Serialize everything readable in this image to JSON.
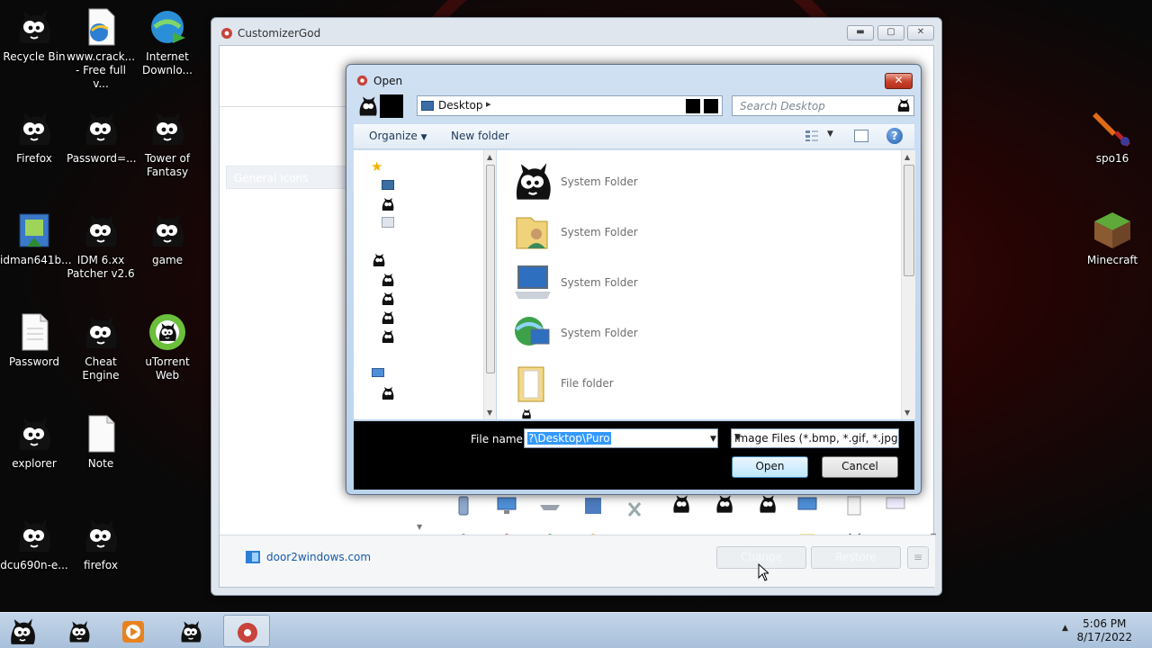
{
  "desktop": {
    "icons": [
      {
        "label": "Recycle Bin",
        "icon": "puro-icon"
      },
      {
        "label": "www.crack...\n- Free full v...",
        "icon": "ie-icon"
      },
      {
        "label": "Internet\nDownlo...",
        "icon": "idm-icon"
      },
      {
        "label": "Firefox",
        "icon": "puro-icon"
      },
      {
        "label": "Password=...",
        "icon": "puro-icon"
      },
      {
        "label": "Tower of\nFantasy",
        "icon": "puro-icon"
      },
      {
        "label": "idman641b...",
        "icon": "installer-icon"
      },
      {
        "label": "IDM 6.xx\nPatcher v2.6",
        "icon": "puro-icon"
      },
      {
        "label": "game",
        "icon": "puro-icon"
      },
      {
        "label": "Password",
        "icon": "text-file-icon"
      },
      {
        "label": "Cheat Engine",
        "icon": "puro-icon"
      },
      {
        "label": "uTorrent\nWeb",
        "icon": "utorrent-icon"
      },
      {
        "label": "explorer",
        "icon": "puro-icon"
      },
      {
        "label": "Note",
        "icon": "text-file-icon"
      },
      {
        "label": "dcu690n-e...",
        "icon": "puro-icon"
      },
      {
        "label": "firefox",
        "icon": "puro-icon"
      },
      {
        "label": "spo16",
        "icon": "sword-icon"
      },
      {
        "label": "Minecraft",
        "icon": "minecraft-icon"
      }
    ]
  },
  "customizer": {
    "title": "CustomizerGod",
    "left_panel_label": "General Icons",
    "footer_link": "door2windows.com",
    "change_label": "Change",
    "restore_label": "Restore",
    "menu_label": "≡"
  },
  "open_dialog": {
    "title": "Open",
    "close_label": "✕",
    "location": "Desktop",
    "search_placeholder": "Search Desktop",
    "organize_label": "Organize",
    "new_folder_label": "New folder",
    "help_label": "?",
    "files": [
      {
        "type": "System Folder",
        "icon": "puro-icon"
      },
      {
        "type": "System Folder",
        "icon": "user-folder-icon"
      },
      {
        "type": "System Folder",
        "icon": "computer-icon"
      },
      {
        "type": "System Folder",
        "icon": "network-icon"
      },
      {
        "type": "File folder",
        "icon": "folder-icon"
      }
    ],
    "file_name_label": "File name:",
    "file_name_value": "?\\Desktop\\Puro",
    "file_type_value": "Image Files (*.bmp, *.gif, *.jpg,",
    "open_label": "Open",
    "cancel_label": "Cancel"
  },
  "taskbar": {
    "time": "5:06 PM",
    "date": "8/17/2022"
  },
  "colors": {
    "taskbar": "#b8cbe2",
    "dialog_frame": "#c7dbf0",
    "selection": "#3399ff",
    "close_button": "#c8412a"
  }
}
